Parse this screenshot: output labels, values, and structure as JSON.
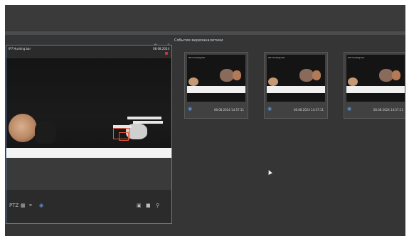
{
  "live_view": {
    "camera_title": "IP7 Hunting bar",
    "date": "08.08.2024",
    "toolbar_left_label": "PTZ"
  },
  "events": {
    "title": "Событие видеоаналитики",
    "items": [
      {
        "thumb_title": "IP7 Hunting bar",
        "time": "08.08.2024 14:57:11"
      },
      {
        "thumb_title": "IP7 Hunting bar",
        "time": "08.08.2024 14:57:11"
      },
      {
        "thumb_title": "IP7 Hunting bar",
        "time": "08.08.2024 14:57:11"
      }
    ]
  },
  "icons": {
    "panel_gear": "gear-icon",
    "panel_expand": "expand-icon",
    "rec": "record-icon",
    "toolbar": [
      "grid-icon",
      "crop-icon",
      "settings-icon",
      "layout-icon",
      "camera-icon",
      "zoom-icon"
    ]
  },
  "colors": {
    "accent": "#5c8ed8",
    "panel_border": "#5b7ea8",
    "detection_box": "#e05a3c"
  }
}
